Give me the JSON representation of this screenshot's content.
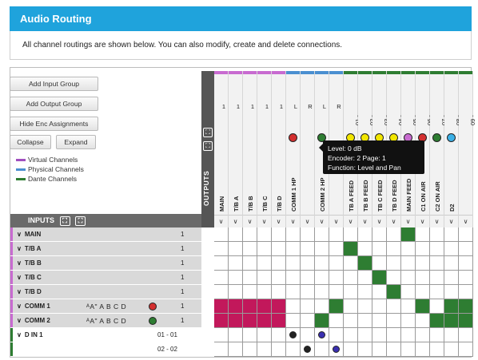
{
  "header": {
    "title": "Audio Routing",
    "description": "All channel routings are shown below. You can also modify, create and delete connections."
  },
  "buttons": {
    "add_input_group": "Add Input Group",
    "add_output_group": "Add Output Group",
    "hide_enc": "Hide Enc Assignments",
    "collapse": "Collapse",
    "expand": "Expand"
  },
  "legend": [
    {
      "label": "Virtual Channels",
      "color": "#a04fbf"
    },
    {
      "label": "Physical Channels",
      "color": "#4a8fd0"
    },
    {
      "label": "Dante Channels",
      "color": "#2e7d32"
    }
  ],
  "outputs_label": "OUTPUTS",
  "inputs_label": "INPUTS",
  "expand_glyph": "⛶",
  "chevron_down": "∨",
  "columns": [
    {
      "name": "MAIN",
      "top": "1",
      "color": "#c86bd0",
      "knob": ""
    },
    {
      "name": "T/B A",
      "top": "1",
      "color": "#c86bd0",
      "knob": ""
    },
    {
      "name": "T/B B",
      "top": "1",
      "color": "#c86bd0",
      "knob": ""
    },
    {
      "name": "T/B C",
      "top": "1",
      "color": "#c86bd0",
      "knob": ""
    },
    {
      "name": "T/B D",
      "top": "1",
      "color": "#c86bd0",
      "knob": ""
    },
    {
      "name": "COMM 1 HP",
      "top": "L",
      "color": "#4a8fd0",
      "knob": "#d32f2f"
    },
    {
      "name": "",
      "top": "R",
      "color": "#4a8fd0",
      "knob": ""
    },
    {
      "name": "COMM 2 HP",
      "top": "L",
      "color": "#4a8fd0",
      "knob": "#2e7d32"
    },
    {
      "name": "",
      "top": "R",
      "color": "#4a8fd0",
      "knob": ""
    },
    {
      "name": "TB A FEED",
      "top": "01 -",
      "color": "#2e7d32",
      "knob": "#f2e600"
    },
    {
      "name": "TB B FEED",
      "top": "02 -",
      "color": "#2e7d32",
      "knob": "#f2e600"
    },
    {
      "name": "TB C FEED",
      "top": "03 -",
      "color": "#2e7d32",
      "knob": "#f2e600"
    },
    {
      "name": "TB D FEED",
      "top": "04 -",
      "color": "#2e7d32",
      "knob": "#f2e600"
    },
    {
      "name": "MAIN FEED",
      "top": "05 -",
      "color": "#2e7d32",
      "knob": "#c86bd0"
    },
    {
      "name": "C1 ON AIR",
      "top": "06 -",
      "color": "#2e7d32",
      "knob": "#d32f2f"
    },
    {
      "name": "C2 ON AIR",
      "top": "07 -",
      "color": "#2e7d32",
      "knob": "#2e7d32"
    },
    {
      "name": "D2",
      "top": "08 -",
      "color": "#2e7d32",
      "knob": "#3bb0e6"
    },
    {
      "name": "",
      "top": "09 -",
      "color": "#2e7d32",
      "knob": ""
    }
  ],
  "rows": [
    {
      "name": "MAIN",
      "num": "1",
      "groups": "",
      "ind": "",
      "ch": "",
      "bar": "#c86bd0"
    },
    {
      "name": "T/B A",
      "num": "1",
      "groups": "",
      "ind": "",
      "ch": "",
      "bar": "#c86bd0"
    },
    {
      "name": "T/B B",
      "num": "1",
      "groups": "",
      "ind": "",
      "ch": "",
      "bar": "#c86bd0"
    },
    {
      "name": "T/B C",
      "num": "1",
      "groups": "",
      "ind": "",
      "ch": "",
      "bar": "#c86bd0"
    },
    {
      "name": "T/B D",
      "num": "1",
      "groups": "",
      "ind": "",
      "ch": "",
      "bar": "#c86bd0"
    },
    {
      "name": "COMM 1",
      "num": "1",
      "groups": "ᴬA\" A B C D",
      "ind": "#d32f2f",
      "ch": "",
      "bar": "#c86bd0"
    },
    {
      "name": "COMM 2",
      "num": "1",
      "groups": "ᴬA\" A B C D",
      "ind": "#2e7d32",
      "ch": "",
      "bar": "#c86bd0"
    },
    {
      "name": "D IN 1",
      "num": "",
      "groups": "",
      "ind": "",
      "ch": "01 - 01",
      "bar": "#2e7d32"
    },
    {
      "name": "",
      "num": "",
      "groups": "",
      "ind": "",
      "ch": "02 - 02",
      "bar": "#2e7d32"
    }
  ],
  "matrix": {
    "magenta_cells": [
      [
        5,
        0
      ],
      [
        5,
        1
      ],
      [
        5,
        2
      ],
      [
        5,
        3
      ],
      [
        5,
        4
      ],
      [
        6,
        0
      ],
      [
        6,
        1
      ],
      [
        6,
        2
      ],
      [
        6,
        3
      ],
      [
        6,
        4
      ]
    ],
    "green_cells": [
      [
        0,
        13
      ],
      [
        1,
        9
      ],
      [
        2,
        10
      ],
      [
        3,
        11
      ],
      [
        4,
        12
      ],
      [
        5,
        8
      ],
      [
        5,
        14
      ],
      [
        5,
        16
      ],
      [
        5,
        17
      ],
      [
        6,
        7
      ],
      [
        6,
        15
      ],
      [
        6,
        16
      ],
      [
        6,
        17
      ]
    ],
    "small_markers": [
      [
        7,
        5,
        "#222"
      ],
      [
        7,
        7,
        "#3a2fb0"
      ],
      [
        8,
        6,
        "#222"
      ],
      [
        8,
        8,
        "#3a2fb0"
      ]
    ]
  },
  "tooltip": {
    "level": "Level: 0 dB",
    "encoder": "Encoder: 2  Page: 1",
    "function": "Function: Level and Pan"
  }
}
